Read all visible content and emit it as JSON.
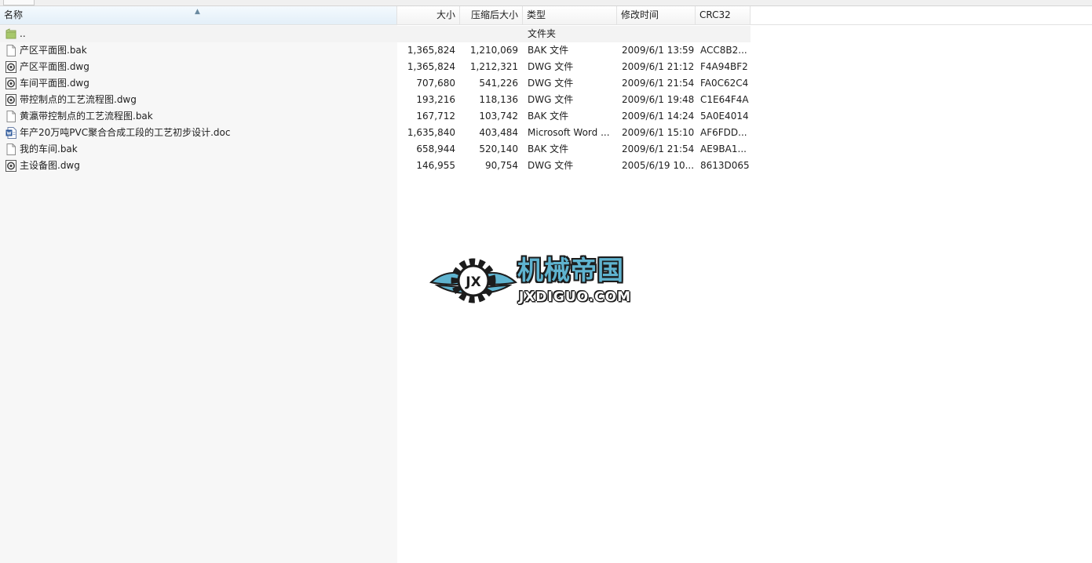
{
  "columns": {
    "name": "名称",
    "size": "大小",
    "packed": "压缩后大小",
    "type": "类型",
    "modified": "修改时间",
    "crc": "CRC32"
  },
  "parent_row": {
    "name": "..",
    "type": "文件夹",
    "icon": "folder-icon"
  },
  "files": [
    {
      "name": "产区平面图.bak",
      "size": "1,365,824",
      "packed": "1,210,069",
      "type": "BAK 文件",
      "modified": "2009/6/1 13:59",
      "crc": "ACC8B2...",
      "icon": "blank-file-icon"
    },
    {
      "name": "产区平面图.dwg",
      "size": "1,365,824",
      "packed": "1,212,321",
      "type": "DWG 文件",
      "modified": "2009/6/1 21:12",
      "crc": "F4A94BF2",
      "icon": "dwg-file-icon"
    },
    {
      "name": "车间平面图.dwg",
      "size": "707,680",
      "packed": "541,226",
      "type": "DWG 文件",
      "modified": "2009/6/1 21:54",
      "crc": "FA0C62C4",
      "icon": "dwg-file-icon"
    },
    {
      "name": "带控制点的工艺流程图.dwg",
      "size": "193,216",
      "packed": "118,136",
      "type": "DWG 文件",
      "modified": "2009/6/1 19:48",
      "crc": "C1E64F4A",
      "icon": "dwg-file-icon"
    },
    {
      "name": "黄瀛带控制点的工艺流程图.bak",
      "size": "167,712",
      "packed": "103,742",
      "type": "BAK 文件",
      "modified": "2009/6/1 14:24",
      "crc": "5A0E4014",
      "icon": "blank-file-icon"
    },
    {
      "name": "年产20万吨PVC聚合合成工段的工艺初步设计.doc",
      "size": "1,635,840",
      "packed": "403,484",
      "type": "Microsoft Word ...",
      "modified": "2009/6/1 15:10",
      "crc": "AF6FDD...",
      "icon": "word-doc-icon"
    },
    {
      "name": "我的车间.bak",
      "size": "658,944",
      "packed": "520,140",
      "type": "BAK 文件",
      "modified": "2009/6/1 21:54",
      "crc": "AE9BA1...",
      "icon": "blank-file-icon"
    },
    {
      "name": "主设备图.dwg",
      "size": "146,955",
      "packed": "90,754",
      "type": "DWG 文件",
      "modified": "2005/6/19 10...",
      "crc": "8613D065",
      "icon": "dwg-file-icon"
    }
  ],
  "watermark": {
    "title": "机械帝国",
    "site": "JXDIGUO.COM",
    "emblem_text": "JX"
  },
  "colors": {
    "accent": "#5fb3cf",
    "header_sorted": "#e3eff8",
    "folder": "#a7c86a"
  }
}
